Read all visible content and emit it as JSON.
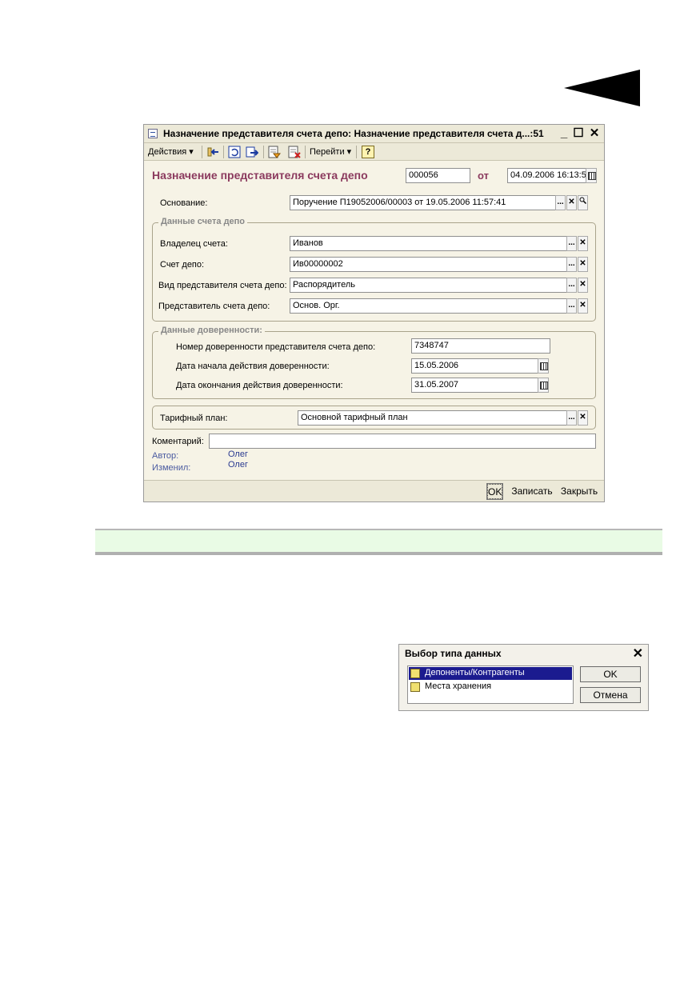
{
  "window": {
    "title": "Назначение представителя счета депо: Назначение представителя счета д...:51",
    "minimize": "_",
    "maximize": "☐",
    "close": "✕"
  },
  "toolbar": {
    "actions": "Действия ▾",
    "goto": "Перейти ▾",
    "help": "?"
  },
  "doc": {
    "title": "Назначение представителя счета депо",
    "number": "000056",
    "from_label": "от",
    "date": "04.09.2006 16:13:5"
  },
  "basis": {
    "label": "Основание:",
    "value": "Поручение П19052006/00003 от 19.05.2006 11:57:41"
  },
  "depo_group": {
    "title": "Данные счета депо",
    "owner_label": "Владелец счета:",
    "owner_value": "Иванов",
    "account_label": "Счет депо:",
    "account_value": "Ив00000002",
    "rep_type_label": "Вид представителя счета депо:",
    "rep_type_value": "Распорядитель",
    "rep_label": "Представитель счета депо:",
    "rep_value": "Основ. Орг."
  },
  "poa_group": {
    "title": "Данные доверенности:",
    "number_label": "Номер доверенности представителя счета депо:",
    "number_value": "7348747",
    "start_label": "Дата начала действия доверенности:",
    "start_value": "15.05.2006",
    "end_label": "Дата окончания действия доверенности:",
    "end_value": "31.05.2007"
  },
  "tariff": {
    "label": "Тарифный план:",
    "value": "Основной тарифный план"
  },
  "comment": {
    "label": "Коментарий:",
    "value": ""
  },
  "meta": {
    "author_label": "Автор:",
    "author_value": "Олег",
    "changed_label": "Изменил:",
    "changed_value": "Олег"
  },
  "buttons": {
    "ok": "OK",
    "save": "Записать",
    "close": "Закрыть",
    "select": "...",
    "clear": "✕"
  },
  "type_dialog": {
    "title": "Выбор типа данных",
    "close": "✕",
    "items": [
      "Депоненты/Контрагенты",
      "Места хранения"
    ],
    "ok": "OK",
    "cancel": "Отмена"
  }
}
